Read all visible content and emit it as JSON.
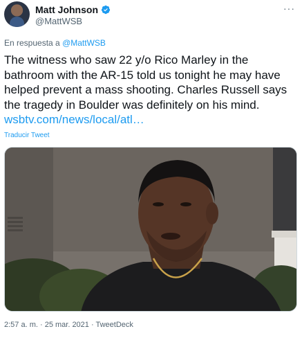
{
  "author": {
    "display_name": "Matt Johnson",
    "handle": "@MattWSB",
    "verified_icon": "verified-badge-icon",
    "avatar": "avatar"
  },
  "more_icon": "more-icon",
  "more_glyph": "···",
  "reply": {
    "prefix": "En respuesta a ",
    "mention": "@MattWSB"
  },
  "tweet": {
    "text": "The witness who saw 22 y/o Rico Marley in the bathroom with the AR-15 told us tonight he may have helped prevent a mass shooting. Charles Russell says the tragedy in Boulder was definitely on his mind. ",
    "link": "wsbtv.com/news/local/atl…"
  },
  "translate_label": "Traducir Tweet",
  "media": {
    "type": "photo",
    "description": "media-photo"
  },
  "meta": {
    "time": "2:57 a. m.",
    "separator1": " · ",
    "date": "25 mar. 2021",
    "separator2": " · ",
    "source": "TweetDeck"
  },
  "colors": {
    "accent": "#1d9bf0",
    "text": "#0f1419",
    "secondary": "#536471"
  }
}
